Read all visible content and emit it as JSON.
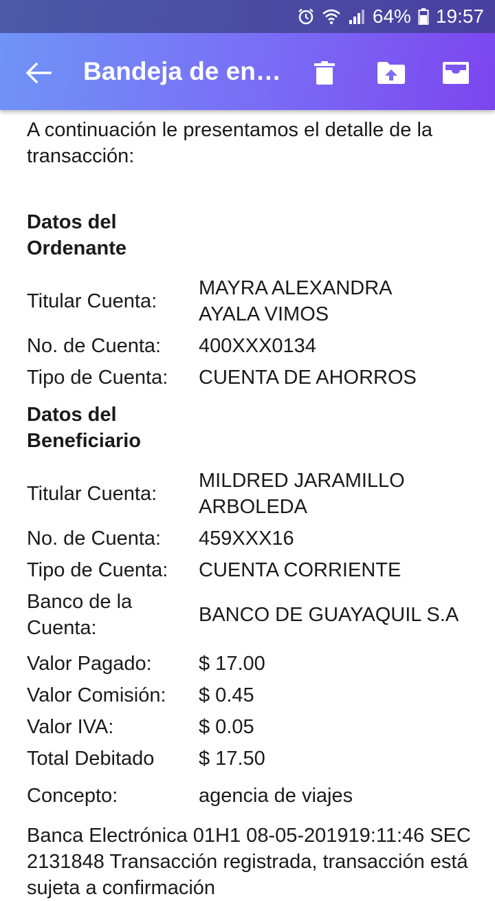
{
  "status_bar": {
    "battery": "64%",
    "time": "19:57",
    "icons": [
      "alarm-icon",
      "wifi-icon",
      "signal-icon",
      "battery-icon"
    ]
  },
  "app_bar": {
    "title": "Bandeja de entrada",
    "icons": [
      "back-arrow-icon",
      "trash-icon",
      "move-to-folder-icon",
      "archive-icon"
    ]
  },
  "email": {
    "intro": "A continuación le presentamos el detalle de la transacción:",
    "ordenante": {
      "title": "Datos del Ordenante",
      "rows": [
        {
          "label": "Titular Cuenta:",
          "value": "MAYRA ALEXANDRA AYALA VIMOS"
        },
        {
          "label": "No. de Cuenta:",
          "value": "400XXX0134"
        },
        {
          "label": "Tipo de Cuenta:",
          "value": "CUENTA DE AHORROS"
        }
      ]
    },
    "beneficiario": {
      "title": "Datos del Beneficiario",
      "rows": [
        {
          "label": "Titular Cuenta:",
          "value": "MILDRED JARAMILLO ARBOLEDA"
        },
        {
          "label": "No. de Cuenta:",
          "value": "459XXX16"
        },
        {
          "label": "Tipo de Cuenta:",
          "value": "CUENTA CORRIENTE"
        },
        {
          "label": "Banco de la Cuenta:",
          "value": "BANCO DE GUAYAQUIL S.A"
        }
      ]
    },
    "valores": [
      {
        "label": "Valor Pagado:",
        "value": "$ 17.00"
      },
      {
        "label": "Valor Comisión:",
        "value": "$ 0.45"
      },
      {
        "label": "Valor IVA:",
        "value": "$ 0.05"
      },
      {
        "label": "Total Debitado",
        "value": "$ 17.50"
      }
    ],
    "concepto": {
      "label": "Concepto:",
      "value": "agencia de viajes"
    },
    "note": "Banca Electrónica 01H1 08-05-201919:11:46 SEC 2131848 Transacción registrada, transacción está sujeta a confirmación"
  }
}
